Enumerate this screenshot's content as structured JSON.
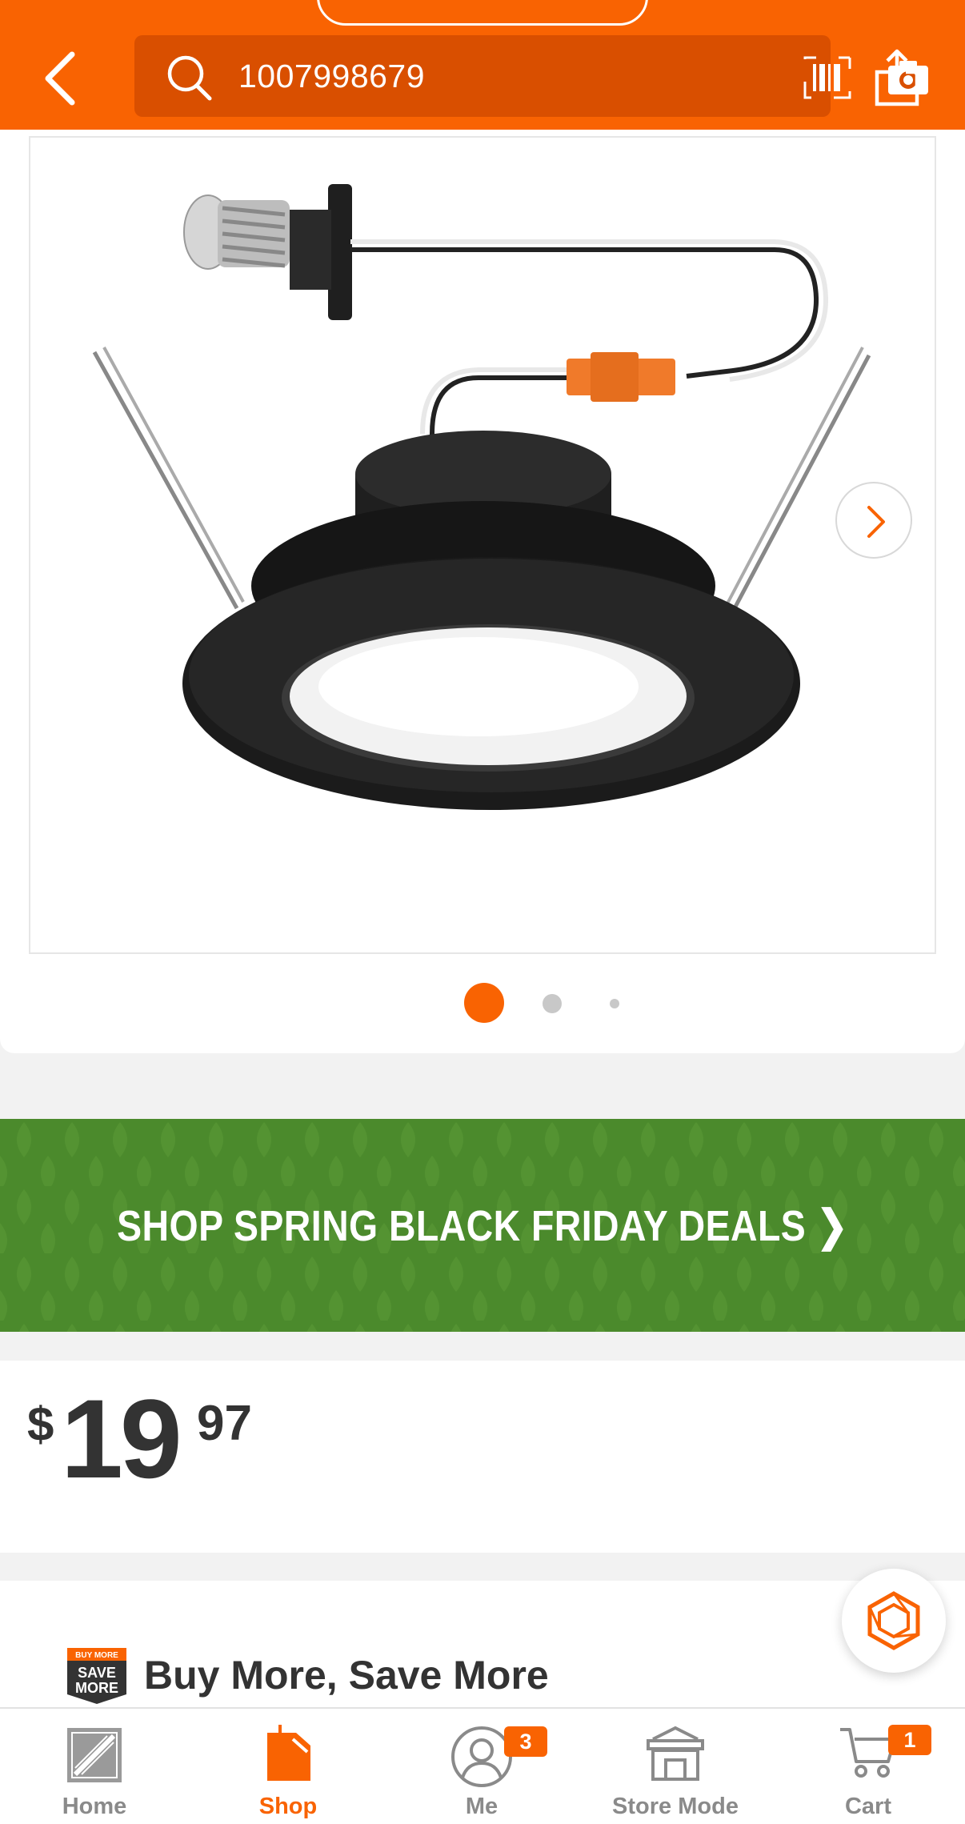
{
  "header": {
    "search_query": "1007998679",
    "icons": [
      "back-chevron-icon",
      "search-icon",
      "barcode-icon",
      "camera-icon",
      "share-icon"
    ]
  },
  "gallery": {
    "image_alt": "",
    "page_count": 3,
    "current_page": 1
  },
  "banner": {
    "text": "SHOP SPRING BLACK FRIDAY DEALS ❯",
    "color": "#4b8a2c"
  },
  "price": {
    "currency": "$",
    "dollars": "19",
    "cents": "97"
  },
  "promo": {
    "badge_line1": "BUY MORE",
    "badge_line2": "SAVE",
    "badge_line3": "MORE",
    "title": "Buy More, Save More"
  },
  "tabs": [
    {
      "label": "Home",
      "icon": "home-depot-logo-icon",
      "active": false
    },
    {
      "label": "Shop",
      "icon": "shop-icon",
      "active": true
    },
    {
      "label": "Me",
      "icon": "user-icon",
      "active": false,
      "badge": "3"
    },
    {
      "label": "Store Mode",
      "icon": "store-icon",
      "active": false
    },
    {
      "label": "Cart",
      "icon": "cart-icon",
      "active": false,
      "badge": "1"
    }
  ],
  "colors": {
    "brand": "#f96302",
    "search_bg": "#d94f00",
    "text": "#333333"
  }
}
